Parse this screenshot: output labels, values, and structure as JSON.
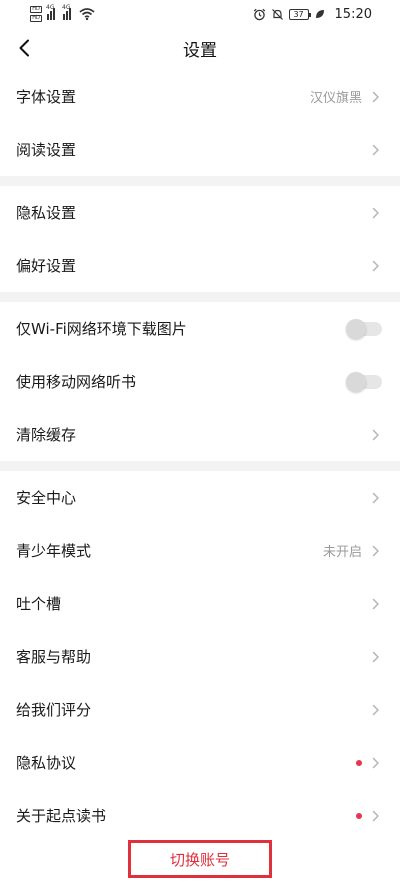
{
  "status_bar": {
    "sim1": "HD",
    "sim2": "HD",
    "net1": "4G",
    "net2": "4G",
    "battery": "37",
    "time": "15:20"
  },
  "header": {
    "title": "设置"
  },
  "groups": [
    [
      {
        "label": "字体设置",
        "value": "汉仪旗黑",
        "control": "chevron"
      },
      {
        "label": "阅读设置",
        "value": "",
        "control": "chevron"
      }
    ],
    [
      {
        "label": "隐私设置",
        "value": "",
        "control": "chevron"
      },
      {
        "label": "偏好设置",
        "value": "",
        "control": "chevron"
      }
    ],
    [
      {
        "label": "仅Wi-Fi网络环境下载图片",
        "value": "",
        "control": "toggle",
        "on": false
      },
      {
        "label": "使用移动网络听书",
        "value": "",
        "control": "toggle",
        "on": false
      },
      {
        "label": "清除缓存",
        "value": "",
        "control": "chevron"
      }
    ],
    [
      {
        "label": "安全中心",
        "value": "",
        "control": "chevron"
      },
      {
        "label": "青少年模式",
        "value": "未开启",
        "control": "chevron"
      },
      {
        "label": "吐个槽",
        "value": "",
        "control": "chevron"
      },
      {
        "label": "客服与帮助",
        "value": "",
        "control": "chevron"
      },
      {
        "label": "给我们评分",
        "value": "",
        "control": "chevron"
      },
      {
        "label": "隐私协议",
        "value": "",
        "control": "chevron",
        "dot": true
      },
      {
        "label": "关于起点读书",
        "value": "",
        "control": "chevron",
        "dot": true
      }
    ]
  ],
  "footer": {
    "switch_account": "切换账号"
  },
  "colors": {
    "accent": "#e0303c",
    "dot": "#e8354d",
    "divider": "#f3f3f3"
  }
}
